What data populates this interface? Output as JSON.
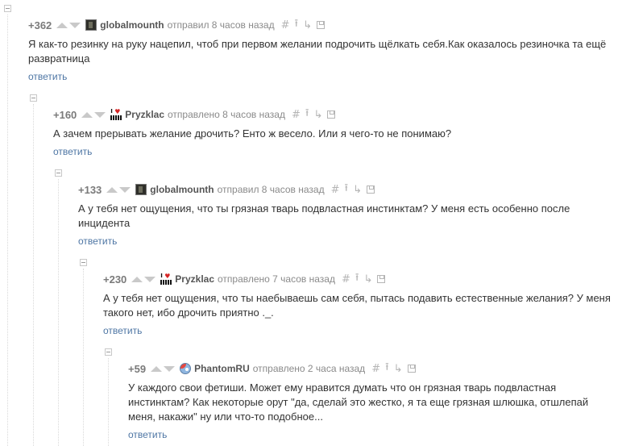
{
  "comments": [
    {
      "rating": "+362",
      "user": "globalmounth",
      "avatar": "dark-figure-avatar",
      "meta": "отправил 8 часов назад",
      "text": "Я как-то резинку на руку нацепил, чтоб при первом желании подрочить щёлкать себя.Как оказалось резиночка та ещё развратница",
      "reply": "ответить"
    },
    {
      "rating": "+160",
      "user": "Pryzklac",
      "avatar": "i-love-avatar",
      "meta": "отправлено 8 часов назад",
      "text": "А зачем прерывать желание дрочить? Енто ж весело. Или я чего-то не понимаю?",
      "reply": "ответить"
    },
    {
      "rating": "+133",
      "user": "globalmounth",
      "avatar": "dark-figure-avatar",
      "meta": "отправил 8 часов назад",
      "text": "А у тебя нет ощущения, что ты грязная тварь подвластная инстинктам? У меня есть особенно после инцидента",
      "reply": "ответить"
    },
    {
      "rating": "+230",
      "user": "Pryzklac",
      "avatar": "i-love-avatar",
      "meta": "отправлено 7 часов назад",
      "text": "А у тебя нет ощущения, что ты наебываешь сам себя, пытась подавить естественные желания? У меня такого нет, ибо дрочить приятно ._.",
      "reply": "ответить"
    },
    {
      "rating": "+59",
      "user": "PhantomRU",
      "avatar": "pony-avatar",
      "meta": "отправлено 2 часа назад",
      "text": "У каждого свои фетиши. Может ему нравится думать что он грязная тварь подвластная инстинктам? Как некоторые орут \"да, сделай это жестко, я та еще грязная шлюшка, отшлепай меня, накажи\" ну или что-то подобное...",
      "reply": "ответить"
    }
  ],
  "icons": {
    "link": "hash-icon",
    "parent": "arrow-up-icon",
    "thread": "branch-icon",
    "save": "save-icon"
  },
  "colors": {
    "reply_link": "#4e76a4",
    "rating": "#7a7a7a",
    "username": "#555555"
  }
}
